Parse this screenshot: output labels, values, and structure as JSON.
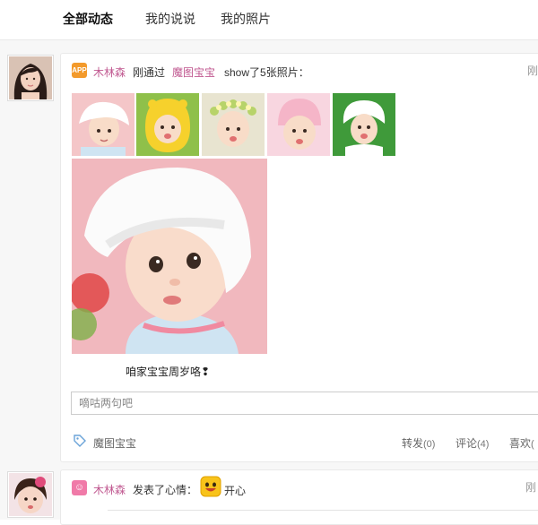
{
  "tabs": [
    {
      "label": "全部动态",
      "active": true
    },
    {
      "label": "我的说说",
      "active": false
    },
    {
      "label": "我的照片",
      "active": false
    }
  ],
  "post1": {
    "app_badge": "APP",
    "author": "木林森",
    "verb": "刚通过",
    "app_name": "魔图宝宝",
    "action": "show了5张照片：",
    "time": "刚",
    "thumbnails": [
      {
        "bg": "#f4c6c8",
        "hat": "#ffffff"
      },
      {
        "bg": "#8fc04a",
        "hat": "#f6d12c"
      },
      {
        "bg": "#e8e4d0",
        "hat": "#ffffff"
      },
      {
        "bg": "#f8d6e0",
        "hat": "#f5b5c8"
      },
      {
        "bg": "#3f9a3a",
        "hat": "#ffffff"
      }
    ],
    "caption": "咱家宝宝周岁咯❢",
    "reply_placeholder": "嘀咕两句吧",
    "tag_label": "魔图宝宝",
    "forward_label": "转发",
    "forward_count": "(0)",
    "comment_label": "评论",
    "comment_count": "(4)",
    "like_label": "喜欢",
    "like_count": "("
  },
  "post2": {
    "author": "木林森",
    "action": "发表了心情：",
    "mood": "开心",
    "time": "刚"
  },
  "colors": {
    "name_pink": "#c05890",
    "app_badge": "#f39a2b",
    "mood_badge": "#f07aa8",
    "mood_face": "#f8c31a"
  }
}
